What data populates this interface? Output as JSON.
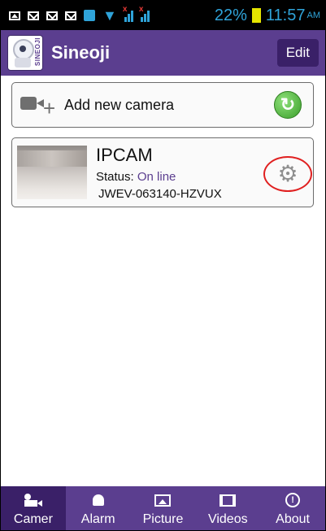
{
  "status_bar": {
    "battery": "22%",
    "time": "11:57",
    "ampm": "AM",
    "icons": [
      "image-icon",
      "mail-icon",
      "mail-icon",
      "mail-icon",
      "sim-icon",
      "wifi-icon",
      "signal-icon",
      "signal-icon",
      "battery-icon"
    ]
  },
  "header": {
    "logo_text": "SINEOJI",
    "title": "Sineoji",
    "edit_label": "Edit",
    "background": "#5b3e8f"
  },
  "add_camera": {
    "label": "Add new camera",
    "icons": [
      "video-add-icon",
      "refresh-icon"
    ]
  },
  "camera": {
    "name": "IPCAM",
    "status_label": "Status:",
    "status_value": "On line",
    "uid": "JWEV-063140-HZVUX",
    "settings_icon": "gear-icon",
    "highlight_color": "#e02020"
  },
  "tabs": [
    {
      "label": "Camer",
      "icon": "camera-icon",
      "active": true
    },
    {
      "label": "Alarm",
      "icon": "bell-icon",
      "active": false
    },
    {
      "label": "Picture",
      "icon": "picture-icon",
      "active": false
    },
    {
      "label": "Videos",
      "icon": "film-icon",
      "active": false
    },
    {
      "label": "About",
      "icon": "info-icon",
      "active": false
    }
  ]
}
